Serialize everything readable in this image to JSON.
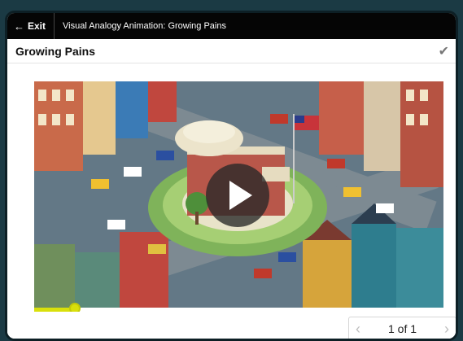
{
  "topbar": {
    "exit_label": "Exit",
    "title": "Visual Analogy Animation: Growing Pains"
  },
  "header": {
    "title": "Growing Pains"
  },
  "video": {
    "progress": 0.1
  },
  "pager": {
    "label": "1 of 1"
  },
  "icons": {
    "exit": "arrow-left-icon",
    "done": "checkmark-icon",
    "play": "play-icon",
    "prev": "chevron-left-icon",
    "next": "chevron-right-icon"
  },
  "colors": {
    "progress": "#d9e00b",
    "topbar": "#050505"
  }
}
